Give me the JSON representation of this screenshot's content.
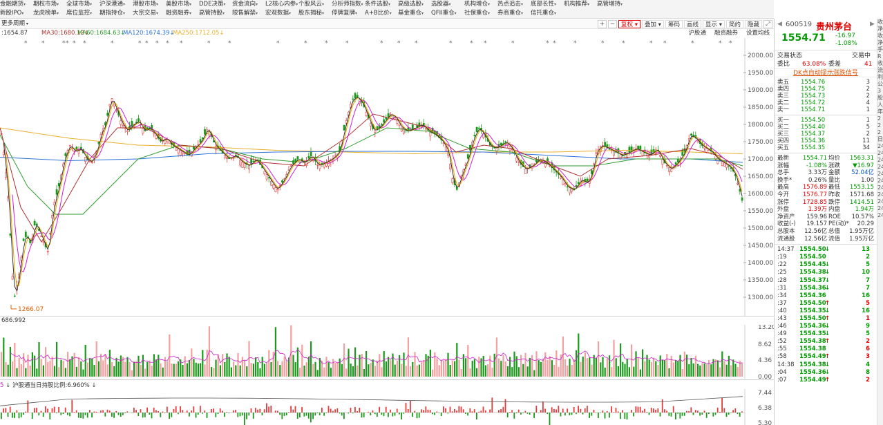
{
  "menu": {
    "row1": [
      "金融期货",
      "期权市场",
      "全球市场",
      "沪深港通",
      "港股市场",
      "美股市场",
      "DDE决策",
      "资金流向",
      "L2核心内参",
      "个股风云",
      "分析师指数",
      "条件选股",
      "高级选股",
      "选股器",
      "机构增仓",
      "热点追击",
      "底部长性",
      "机构推荐",
      "高管增持"
    ],
    "row2": [
      "新股IPO",
      "龙虎榜单",
      "席位监控",
      "期指持仓",
      "大宗交易",
      "融资融券",
      "高管持股",
      "限售解禁",
      "宏观数据",
      "股东揭秘",
      "停牌复牌",
      "A+B比价",
      "基金重仓",
      "QFII重仓",
      "社保重仓",
      "券商重仓",
      "信托重仓"
    ]
  },
  "toolbar": {
    "period": "更多周期",
    "buttons": [
      "复权",
      "叠加",
      "筹码",
      "画线",
      "显示",
      "简约",
      "隐藏"
    ],
    "small": [
      "+",
      "−"
    ]
  },
  "ma": {
    "close": "1654.87",
    "ma30": "MA30:1680.12",
    "ma60": "MA60:1684.63",
    "ma120": "MA120:1674.39",
    "ma250": "MA250:1712.05",
    "tools": [
      "沪股通",
      "融资融券",
      "设置均线"
    ],
    "colors": {
      "ma5": "#333333",
      "ma10": "#e6a800",
      "ma20": "#d01cd0",
      "ma30": "#b03030",
      "ma60": "#2e9d2e",
      "ma120": "#2b72d8",
      "ma250": "#e8b02c"
    }
  },
  "price_axis": {
    "ticks": [
      2000,
      1950,
      1900,
      1850,
      1800,
      1750,
      1700,
      1650,
      1600,
      1550,
      1500,
      1450,
      1400,
      1350,
      1300
    ]
  },
  "low_marker": "1266.07",
  "volume": {
    "label": "686.992",
    "ticks": [
      "13.20",
      "8.62",
      "4.36",
      "0.00"
    ],
    "tools": [
      "改参数",
      "加指标",
      "换指标"
    ]
  },
  "hgt": {
    "label": "沪股通当日持股比例:6.960%",
    "prefix": "5",
    "ticks": [
      "7.44",
      "6.38",
      "5.30"
    ],
    "tools": [
      "改参数",
      "加指标",
      "换指标"
    ]
  },
  "close_symbol": "×",
  "chart_data": {
    "type": "candlestick",
    "title": "",
    "ylim": [
      1266.07,
      2000
    ],
    "path_points": [
      [
        0,
        1790
      ],
      [
        6,
        1690
      ],
      [
        12,
        1560
      ],
      [
        16,
        1380
      ],
      [
        20,
        1300
      ],
      [
        24,
        1340
      ],
      [
        28,
        1380
      ],
      [
        32,
        1460
      ],
      [
        38,
        1480
      ],
      [
        44,
        1450
      ],
      [
        50,
        1520
      ],
      [
        56,
        1490
      ],
      [
        62,
        1460
      ],
      [
        68,
        1430
      ],
      [
        76,
        1560
      ],
      [
        84,
        1620
      ],
      [
        92,
        1700
      ],
      [
        100,
        1740
      ],
      [
        108,
        1720
      ],
      [
        116,
        1730
      ],
      [
        124,
        1700
      ],
      [
        132,
        1690
      ],
      [
        140,
        1730
      ],
      [
        146,
        1780
      ],
      [
        152,
        1800
      ],
      [
        160,
        1880
      ],
      [
        168,
        1840
      ],
      [
        176,
        1800
      ],
      [
        184,
        1780
      ],
      [
        192,
        1800
      ],
      [
        200,
        1810
      ],
      [
        208,
        1780
      ],
      [
        216,
        1790
      ],
      [
        224,
        1770
      ],
      [
        232,
        1750
      ],
      [
        240,
        1760
      ],
      [
        248,
        1740
      ],
      [
        256,
        1730
      ],
      [
        264,
        1720
      ],
      [
        272,
        1710
      ],
      [
        280,
        1730
      ],
      [
        290,
        1750
      ],
      [
        300,
        1790
      ],
      [
        310,
        1740
      ],
      [
        320,
        1720
      ],
      [
        330,
        1700
      ],
      [
        340,
        1710
      ],
      [
        350,
        1690
      ],
      [
        360,
        1680
      ],
      [
        370,
        1700
      ],
      [
        380,
        1670
      ],
      [
        390,
        1640
      ],
      [
        400,
        1610
      ],
      [
        410,
        1640
      ],
      [
        420,
        1680
      ],
      [
        430,
        1700
      ],
      [
        440,
        1690
      ],
      [
        450,
        1710
      ],
      [
        460,
        1680
      ],
      [
        470,
        1690
      ],
      [
        480,
        1700
      ],
      [
        490,
        1720
      ],
      [
        500,
        1810
      ],
      [
        508,
        1870
      ],
      [
        516,
        1880
      ],
      [
        524,
        1860
      ],
      [
        532,
        1820
      ],
      [
        540,
        1780
      ],
      [
        548,
        1790
      ],
      [
        556,
        1810
      ],
      [
        564,
        1830
      ],
      [
        572,
        1820
      ],
      [
        580,
        1790
      ],
      [
        590,
        1780
      ],
      [
        600,
        1790
      ],
      [
        610,
        1800
      ],
      [
        620,
        1780
      ],
      [
        630,
        1770
      ],
      [
        640,
        1750
      ],
      [
        648,
        1720
      ],
      [
        654,
        1640
      ],
      [
        660,
        1610
      ],
      [
        668,
        1660
      ],
      [
        676,
        1700
      ],
      [
        684,
        1760
      ],
      [
        692,
        1790
      ],
      [
        700,
        1770
      ],
      [
        708,
        1740
      ],
      [
        716,
        1730
      ],
      [
        724,
        1740
      ],
      [
        732,
        1750
      ],
      [
        740,
        1730
      ],
      [
        750,
        1690
      ],
      [
        760,
        1670
      ],
      [
        770,
        1680
      ],
      [
        780,
        1700
      ],
      [
        790,
        1690
      ],
      [
        800,
        1670
      ],
      [
        810,
        1650
      ],
      [
        820,
        1620
      ],
      [
        830,
        1610
      ],
      [
        840,
        1640
      ],
      [
        850,
        1630
      ],
      [
        856,
        1660
      ],
      [
        862,
        1720
      ],
      [
        870,
        1740
      ],
      [
        880,
        1730
      ],
      [
        890,
        1720
      ],
      [
        900,
        1710
      ],
      [
        910,
        1720
      ],
      [
        920,
        1730
      ],
      [
        930,
        1720
      ],
      [
        940,
        1710
      ],
      [
        950,
        1730
      ],
      [
        960,
        1690
      ],
      [
        970,
        1670
      ],
      [
        980,
        1690
      ],
      [
        990,
        1720
      ],
      [
        998,
        1770
      ],
      [
        1006,
        1760
      ],
      [
        1014,
        1740
      ],
      [
        1022,
        1730
      ],
      [
        1030,
        1720
      ],
      [
        1038,
        1700
      ],
      [
        1046,
        1690
      ],
      [
        1054,
        1680
      ],
      [
        1062,
        1660
      ],
      [
        1068,
        1620
      ],
      [
        1072,
        1590
      ],
      [
        1075,
        1560
      ]
    ],
    "ma_points": {
      "ma250": [
        [
          0,
          1790
        ],
        [
          100,
          1760
        ],
        [
          200,
          1740
        ],
        [
          300,
          1735
        ],
        [
          400,
          1725
        ],
        [
          500,
          1720
        ],
        [
          600,
          1715
        ],
        [
          700,
          1720
        ],
        [
          800,
          1720
        ],
        [
          900,
          1725
        ],
        [
          1000,
          1720
        ],
        [
          1075,
          1715
        ]
      ],
      "ma120": [
        [
          0,
          1705
        ],
        [
          100,
          1695
        ],
        [
          200,
          1700
        ],
        [
          300,
          1715
        ],
        [
          400,
          1720
        ],
        [
          500,
          1722
        ],
        [
          600,
          1722
        ],
        [
          700,
          1720
        ],
        [
          800,
          1710
        ],
        [
          900,
          1700
        ],
        [
          1000,
          1700
        ],
        [
          1075,
          1690
        ]
      ],
      "ma60": [
        [
          0,
          1770
        ],
        [
          40,
          1620
        ],
        [
          80,
          1540
        ],
        [
          120,
          1540
        ],
        [
          160,
          1620
        ],
        [
          200,
          1700
        ],
        [
          260,
          1740
        ],
        [
          320,
          1730
        ],
        [
          380,
          1700
        ],
        [
          440,
          1690
        ],
        [
          500,
          1730
        ],
        [
          560,
          1790
        ],
        [
          620,
          1780
        ],
        [
          680,
          1730
        ],
        [
          740,
          1720
        ],
        [
          800,
          1680
        ],
        [
          860,
          1680
        ],
        [
          920,
          1700
        ],
        [
          980,
          1700
        ],
        [
          1040,
          1700
        ],
        [
          1075,
          1680
        ]
      ],
      "ma30": [
        [
          0,
          1790
        ],
        [
          30,
          1560
        ],
        [
          60,
          1460
        ],
        [
          90,
          1560
        ],
        [
          130,
          1700
        ],
        [
          170,
          1790
        ],
        [
          210,
          1790
        ],
        [
          260,
          1740
        ],
        [
          320,
          1730
        ],
        [
          380,
          1690
        ],
        [
          440,
          1680
        ],
        [
          500,
          1760
        ],
        [
          540,
          1830
        ],
        [
          580,
          1810
        ],
        [
          620,
          1790
        ],
        [
          660,
          1720
        ],
        [
          700,
          1740
        ],
        [
          740,
          1730
        ],
        [
          800,
          1680
        ],
        [
          840,
          1650
        ],
        [
          880,
          1700
        ],
        [
          940,
          1710
        ],
        [
          1000,
          1730
        ],
        [
          1040,
          1710
        ],
        [
          1075,
          1670
        ]
      ]
    },
    "volume_series": [
      6.2,
      12.8,
      5.1,
      4.3,
      6.8,
      3.9,
      7.1,
      2.8,
      5.5,
      4.2,
      9.1,
      3.6,
      6.4,
      2.9,
      5.8,
      4.7,
      3.3,
      7.6,
      4.1,
      2.5,
      6.9,
      3.8,
      5.2,
      4.6,
      2.7,
      8.2,
      3.4,
      5.9,
      4.4,
      2.6,
      6.1,
      3.7,
      4.9,
      7.4,
      3.1,
      5.6,
      4.0,
      2.9,
      6.6,
      3.5,
      5.3,
      4.8,
      2.4,
      7.8,
      3.9,
      5.1,
      4.3,
      6.4,
      3.2,
      5.7,
      4.5,
      2.8,
      6.2,
      3.6,
      8.9,
      4.1,
      3.3,
      5.8,
      4.7,
      2.6,
      6.5,
      3.9,
      5.0,
      4.4,
      7.2,
      3.0,
      5.4,
      4.2,
      2.7,
      6.8,
      3.7,
      5.5,
      4.9,
      2.5,
      6.0,
      3.4,
      9.6,
      4.6,
      3.1,
      5.2,
      4.3,
      6.7,
      2.9,
      5.6,
      4.0,
      3.5,
      7.0,
      3.8,
      5.1,
      4.5,
      2.8,
      6.3,
      3.2,
      5.8,
      10.4,
      4.1,
      3.6,
      6.1,
      4.8,
      2.7,
      5.4,
      3.9,
      7.5,
      4.2,
      3.0,
      5.9,
      4.4,
      6.6,
      3.3,
      5.0,
      4.7,
      2.6,
      8.1,
      3.8,
      5.3,
      4.0,
      6.4,
      3.5,
      5.7,
      4.3,
      2.9,
      6.9,
      3.7,
      5.2,
      11.8,
      4.6,
      3.1,
      5.5,
      4.1,
      6.2
    ]
  },
  "right": {
    "code": "600519",
    "name": "贵州茅台",
    "price": "1554.71",
    "change": "-16.97",
    "change_pct": "-1.08%",
    "status_label": "交易状态",
    "status_value": "交易中",
    "weibi_label": "委比",
    "weibi_value": "63.08%",
    "weicha_label": "委差",
    "weicha_value": "41",
    "dk_banner": "DK点自动提示涨跌信号",
    "asks": [
      {
        "label": "卖五",
        "price": "1554.76",
        "vol": "3"
      },
      {
        "label": "卖四",
        "price": "1554.75",
        "vol": "2"
      },
      {
        "label": "卖三",
        "price": "1554.73",
        "vol": "2"
      },
      {
        "label": "卖二",
        "price": "1554.72",
        "vol": "4"
      },
      {
        "label": "卖一",
        "price": "1554.71",
        "vol": "1"
      }
    ],
    "bids": [
      {
        "label": "买一",
        "price": "1554.50",
        "vol": "1"
      },
      {
        "label": "买二",
        "price": "1554.40",
        "vol": "5"
      },
      {
        "label": "买三",
        "price": "1554.37",
        "vol": "2"
      },
      {
        "label": "买四",
        "price": "1554.36",
        "vol": "11"
      },
      {
        "label": "买五",
        "price": "1554.35",
        "vol": "34"
      }
    ],
    "quote": [
      {
        "l1": "最新",
        "v1": "1554.71",
        "c1": "green",
        "l2": "均价",
        "v2": "1563.31",
        "c2": "green"
      },
      {
        "l1": "涨幅",
        "v1": "-1.08%",
        "c1": "green",
        "l2": "涨跌",
        "v2": "▼16.97",
        "c2": "green"
      },
      {
        "l1": "总手",
        "v1": "3.33万",
        "c1": "dark",
        "l2": "金额",
        "v2": "52.04亿",
        "c2": "blue"
      },
      {
        "l1": "换手*",
        "v1": "0.26%",
        "c1": "dark",
        "l2": "量比",
        "v2": "1.00",
        "c2": "dark"
      },
      {
        "l1": "最高",
        "v1": "1576.89",
        "c1": "red",
        "l2": "最低",
        "v2": "1553.15",
        "c2": "green"
      },
      {
        "l1": "今开",
        "v1": "1576.77",
        "c1": "red",
        "l2": "昨收",
        "v2": "1571.68",
        "c2": "dark"
      },
      {
        "l1": "涨停",
        "v1": "1728.85",
        "c1": "red",
        "l2": "跌停",
        "v2": "1414.51",
        "c2": "green"
      },
      {
        "l1": "外盘",
        "v1": "1.39万",
        "c1": "red",
        "l2": "内盘",
        "v2": "1.94万",
        "c2": "green"
      },
      {
        "l1": "净资产",
        "v1": "159.96",
        "c1": "dark",
        "l2": "ROE",
        "v2": "10.57%",
        "c2": "dark"
      },
      {
        "l1": "收益(-)",
        "v1": "19.157",
        "c1": "dark",
        "l2": "PE(动)*",
        "v2": "20.29",
        "c2": "dark"
      },
      {
        "l1": "总股本",
        "v1": "12.56亿",
        "c1": "dark",
        "l2": "总值",
        "v2": "1.95万亿",
        "c2": "dark"
      },
      {
        "l1": "流通股",
        "v1": "12.56亿",
        "c1": "dark",
        "l2": "流值",
        "v2": "1.95万亿",
        "c2": "dark"
      }
    ],
    "ticks": [
      {
        "t": "14:37",
        "p": "1554.50",
        "a": "↓",
        "v": "13",
        "vc": "green"
      },
      {
        "t": ":19",
        "p": "1554.50",
        "a": "",
        "v": "2",
        "vc": "green"
      },
      {
        "t": ":22",
        "p": "1554.45",
        "a": "↓",
        "v": "5",
        "vc": "green"
      },
      {
        "t": ":25",
        "p": "1554.38",
        "a": "↓",
        "v": "10",
        "vc": "green"
      },
      {
        "t": ":28",
        "p": "1554.37",
        "a": "↓",
        "v": "7",
        "vc": "green"
      },
      {
        "t": ":31",
        "p": "1554.36",
        "a": "↓",
        "v": "7",
        "vc": "green"
      },
      {
        "t": ":34",
        "p": "1554.36",
        "a": "",
        "v": "16",
        "vc": "green"
      },
      {
        "t": ":37",
        "p": "1554.50",
        "a": "↑",
        "v": "5",
        "vc": "red"
      },
      {
        "t": ":40",
        "p": "1554.35",
        "a": "↓",
        "v": "16",
        "vc": "green"
      },
      {
        "t": ":43",
        "p": "1554.50",
        "a": "↑",
        "v": "1",
        "vc": "red"
      },
      {
        "t": ":46",
        "p": "1554.36",
        "a": "↓",
        "v": "9",
        "vc": "green"
      },
      {
        "t": ":49",
        "p": "1554.35",
        "a": "↓",
        "v": "5",
        "vc": "green"
      },
      {
        "t": ":52",
        "p": "1554.38",
        "a": "↑",
        "v": "2",
        "vc": "red"
      },
      {
        "t": ":55",
        "p": "1554.38",
        "a": "",
        "v": "6",
        "vc": "red"
      },
      {
        "t": ":58",
        "p": "1554.49",
        "a": "↑",
        "v": "3",
        "vc": "red"
      },
      {
        "t": "14:38",
        "p": "1554.38",
        "a": "↓",
        "v": "4",
        "vc": "green"
      },
      {
        "t": ":04",
        "p": "1554.36",
        "a": "↓",
        "v": "8",
        "vc": "green"
      },
      {
        "t": ":07",
        "p": "1554.49",
        "a": "↑",
        "v": "2",
        "vc": "red"
      }
    ]
  },
  "strip": [
    "收",
    "净",
    "收",
    "净",
    "手",
    "R",
    "收",
    "流",
    "利",
    "",
    "",
    "",
    "公",
    "3",
    "股",
    "人",
    "年",
    "2",
    "2",
    "2",
    "日",
    "24",
    "24",
    "24",
    "24",
    "24",
    "24",
    "24",
    "24",
    "24",
    "24",
    "24"
  ]
}
